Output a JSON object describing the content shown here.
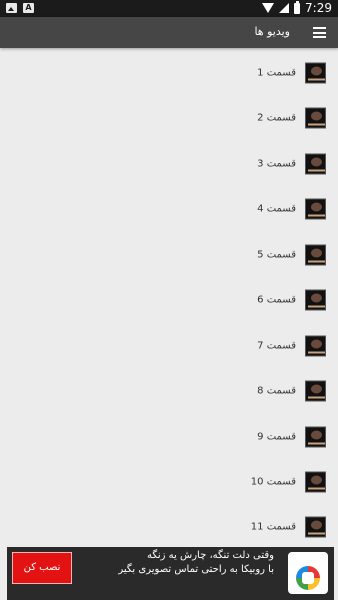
{
  "status_bar": {
    "time": "7:29"
  },
  "app_bar": {
    "title": "ویدیو ها"
  },
  "list": {
    "items": [
      {
        "label": "قسمت 1"
      },
      {
        "label": "قسمت 2"
      },
      {
        "label": "قسمت 3"
      },
      {
        "label": "قسمت 4"
      },
      {
        "label": "قسمت 5"
      },
      {
        "label": "قسمت 6"
      },
      {
        "label": "قسمت 7"
      },
      {
        "label": "قسمت 8"
      },
      {
        "label": "قسمت 9"
      },
      {
        "label": "قسمت 10"
      },
      {
        "label": "قسمت 11"
      }
    ]
  },
  "ad": {
    "install_label": "نصب کن",
    "line1": "وقتی دلت تنگه، چارش یه زنگه",
    "line2": "با روبیکا به راحتی تماس تصویری بگیر"
  }
}
